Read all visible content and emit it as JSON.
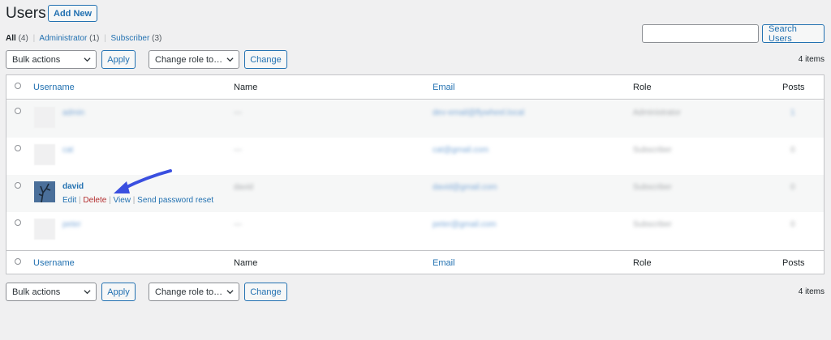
{
  "header": {
    "title": "Users",
    "add_new": "Add New"
  },
  "views": {
    "all_label": "All",
    "all_count": "(4)",
    "admin_label": "Administrator",
    "admin_count": "(1)",
    "sub_label": "Subscriber",
    "sub_count": "(3)",
    "sep": "|"
  },
  "search": {
    "value": "",
    "button": "Search Users"
  },
  "bulk": {
    "label": "Bulk actions",
    "apply": "Apply",
    "role_label": "Change role to…",
    "change": "Change"
  },
  "items_count": "4 items",
  "columns": {
    "username": "Username",
    "name": "Name",
    "email": "Email",
    "role": "Role",
    "posts": "Posts"
  },
  "rows": [
    {
      "username": "admin",
      "name": "—",
      "email": "dev-email@flywheel.local",
      "role": "Administrator",
      "posts": "1"
    },
    {
      "username": "cat",
      "name": "—",
      "email": "cat@gmail.com",
      "role": "Subscriber",
      "posts": "0"
    },
    {
      "username": "david",
      "name": "david",
      "email": "david@gmail.com",
      "role": "Subscriber",
      "posts": "0"
    },
    {
      "username": "peter",
      "name": "—",
      "email": "peter@gmail.com",
      "role": "Subscriber",
      "posts": "0"
    }
  ],
  "row_actions": {
    "edit": "Edit",
    "delete": "Delete",
    "view": "View",
    "reset": "Send password reset",
    "sep": "|"
  },
  "colors": {
    "accent": "#2271b1",
    "danger": "#b32d2e",
    "annotation_arrow": "#3a4fe0"
  }
}
